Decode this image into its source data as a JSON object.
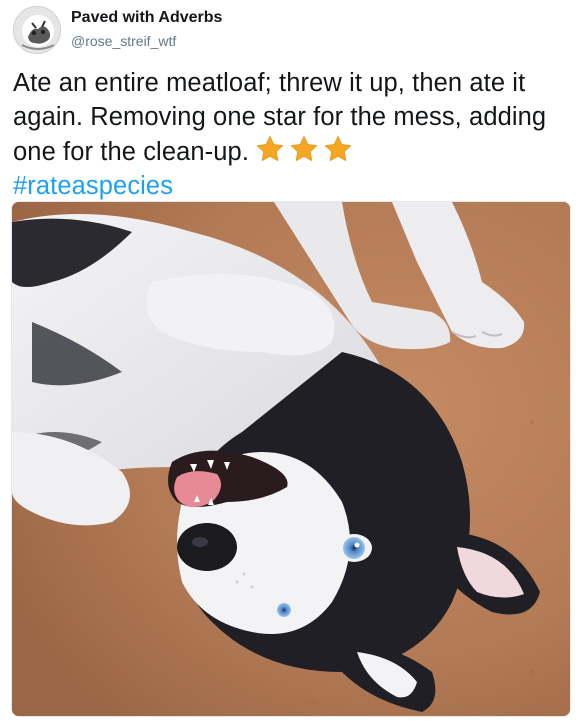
{
  "author": {
    "display_name": "Paved with Adverbs",
    "handle": "@rose_streif_wtf",
    "avatar_icon": "cartoon-dog-avatar-icon"
  },
  "tweet": {
    "text": "Ate an entire meatloaf; threw it up, then ate it again. Removing one star for the mess, adding one for the clean-up.",
    "rating": {
      "stars": 3,
      "icon": "star-emoji-icon",
      "color": "#f5a623"
    },
    "hashtag": "#rateaspecies",
    "hashtag_color": "#1da1f2"
  },
  "media": {
    "type": "photo",
    "icon": "husky-photo"
  }
}
